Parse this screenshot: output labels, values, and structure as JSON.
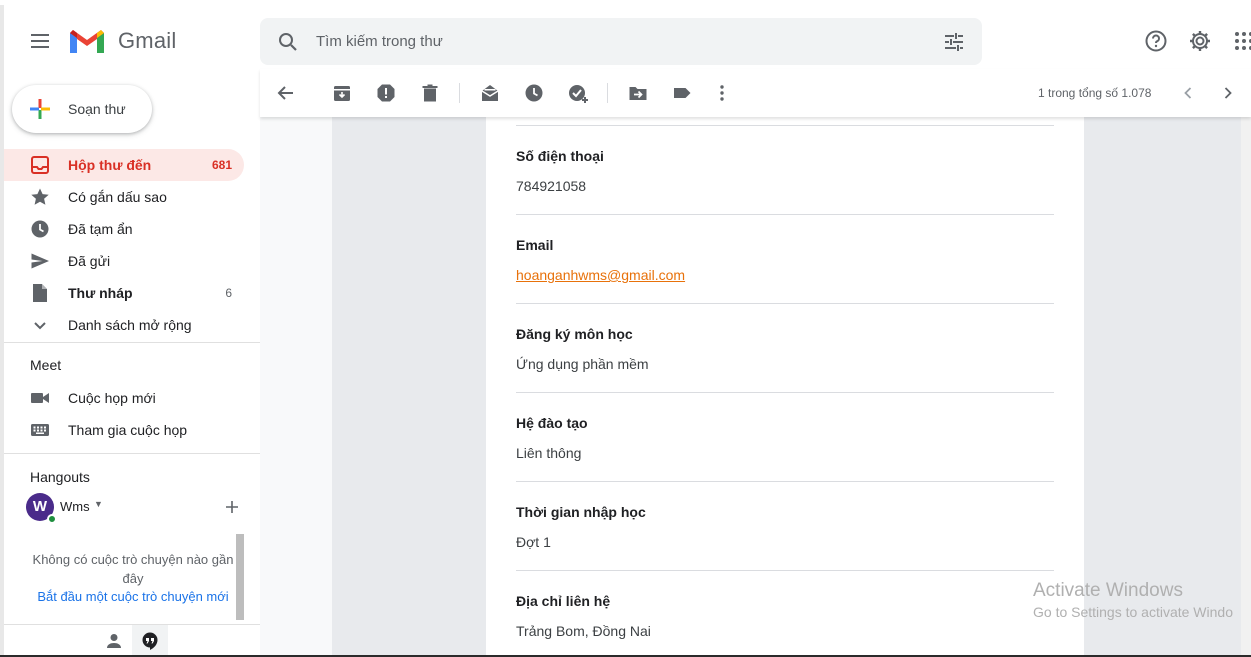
{
  "app": {
    "logo_text": "Gmail"
  },
  "search": {
    "placeholder": "Tìm kiếm trong thư"
  },
  "compose": {
    "label": "Soạn thư"
  },
  "nav": [
    {
      "label": "Hộp thư đến",
      "count": "681"
    },
    {
      "label": "Có gắn dấu sao",
      "count": ""
    },
    {
      "label": "Đã tạm ẩn",
      "count": ""
    },
    {
      "label": "Đã gửi",
      "count": ""
    },
    {
      "label": "Thư nháp",
      "count": "6"
    },
    {
      "label": "Danh sách mở rộng",
      "count": ""
    }
  ],
  "meet": {
    "title": "Meet",
    "items": [
      {
        "label": "Cuộc họp mới"
      },
      {
        "label": "Tham gia cuộc họp"
      }
    ]
  },
  "hangouts": {
    "title": "Hangouts",
    "user_initial": "W",
    "user_name": "Wms",
    "no_chat": "Không có cuộc trò chuyện nào gần đây",
    "start_chat": "Bắt đầu một cuộc trò chuyện mới"
  },
  "toolbar": {
    "pager": "1 trong tổng số 1.078"
  },
  "email": {
    "fields": [
      {
        "label": "Số điện thoại",
        "value": "784921058"
      },
      {
        "label": "Email",
        "value": "hoanganhwms@gmail.com"
      },
      {
        "label": "Đăng ký môn học",
        "value": "Ứng dụng phần mềm"
      },
      {
        "label": "Hệ đào tạo",
        "value": "Liên thông"
      },
      {
        "label": "Thời gian nhập học",
        "value": "Đợt 1"
      },
      {
        "label": "Địa chỉ liên hệ",
        "value": "Trảng Bom, Đồng Nai"
      }
    ]
  },
  "watermark": {
    "line1": "Activate Windows",
    "line2": "Go to Settings to activate Windo"
  },
  "colors": {
    "inbox_active_bg": "#fce8e6",
    "inbox_active_text": "#d93025",
    "link": "#e8710a",
    "accent_blue": "#1a73e8"
  },
  "icons": [
    "menu-icon",
    "gmail-logo-icon",
    "search-icon",
    "tune-icon",
    "help-icon",
    "settings-icon",
    "apps-icon",
    "plus-icon",
    "inbox-icon",
    "star-icon",
    "clock-icon",
    "send-icon",
    "draft-icon",
    "chevron-down-icon",
    "video-icon",
    "keyboard-icon",
    "back-arrow-icon",
    "archive-icon",
    "report-spam-icon",
    "delete-icon",
    "mark-unread-icon",
    "snooze-icon",
    "add-task-icon",
    "move-to-icon",
    "label-icon",
    "more-vert-icon",
    "chevron-left-icon",
    "chevron-right-icon",
    "person-icon",
    "hangouts-icon"
  ]
}
